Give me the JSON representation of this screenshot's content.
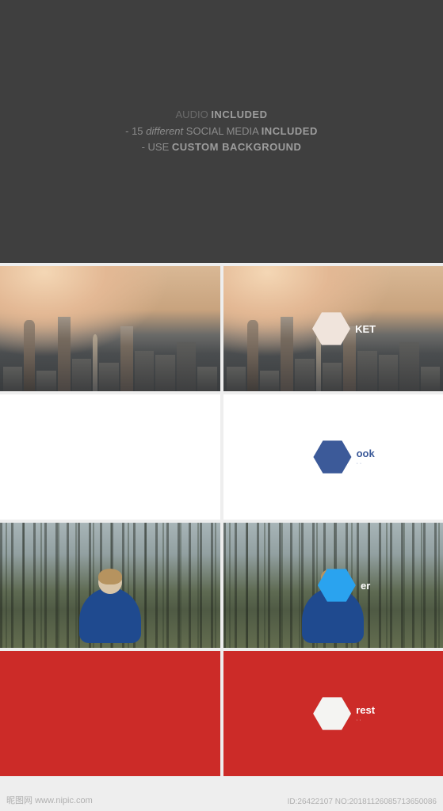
{
  "hero": {
    "line1_prefix": "AUDIO",
    "line1_bold": "INCLUDED",
    "line2_prefix": "- 15",
    "line2_italic": "different",
    "line2_rest": "SOCIAL MEDIA",
    "line2_bold": "INCLUDED",
    "line3_prefix": "- USE",
    "line3_bold": "CUSTOM BACKGROUND"
  },
  "tiles": {
    "city_label": "KET",
    "facebook_label": "ook",
    "facebook_color": "#3c5a99",
    "twitter_label": "er",
    "twitter_color": "#2aa3ef",
    "pinterest_label": "rest",
    "pinterest_hex_fill": "#f4f4f2",
    "pinterest_text_color": "#ffffff"
  },
  "watermark": {
    "site": "昵图网",
    "url": "www.nipic.com"
  },
  "meta": {
    "id_label": "ID:26422107",
    "no_label": "NO:20181126085713650086"
  }
}
